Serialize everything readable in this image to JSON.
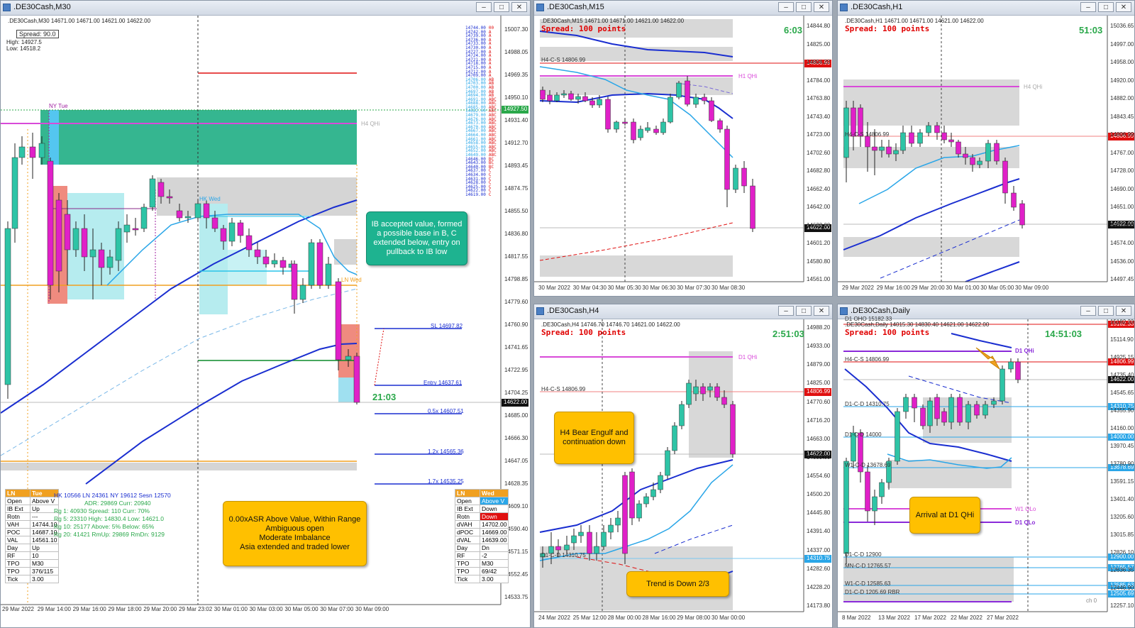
{
  "windows": {
    "m30": {
      "title": ".DE30Cash,M30",
      "header": ".DE30Cash,M30  14671.00 14671.00 14621.00 14622.00",
      "spread": "Spread: 90.0",
      "high": "High: 14927.5",
      "low": "Low: 14518.2",
      "timer": "21:03",
      "labels": {
        "ny_tue": "NY Tue",
        "h4_qhi": "H4 QHi",
        "hk_wed": "HK Wed",
        "ln_wed": "LN Wed"
      },
      "levels": {
        "sl": "SL  14697.82",
        "entry": "Entry  14637.61",
        "x05": "0.5x  14607.51",
        "x12": "1.2x  14565.36",
        "x17": "1.7x  14535.25"
      },
      "price_tags": {
        "green": "14927.50",
        "current": "14622.00"
      },
      "yaxis": [
        "15007.30",
        "14988.05",
        "14969.35",
        "14950.10",
        "14931.40",
        "14912.70",
        "14893.45",
        "14874.75",
        "14855.50",
        "14836.80",
        "14817.55",
        "14798.85",
        "14779.60",
        "14760.90",
        "14741.65",
        "14722.95",
        "14704.25",
        "14685.00",
        "14666.30",
        "14647.05",
        "14628.35",
        "14609.10",
        "14590.40",
        "14571.15",
        "14552.45",
        "14533.75"
      ],
      "xaxis": [
        "29 Mar 2022",
        "29 Mar 14:00",
        "29 Mar 16:00",
        "29 Mar 18:00",
        "29 Mar 20:00",
        "29 Mar 23:02",
        "30 Mar 01:00",
        "30 Mar 03:00",
        "30 Mar 05:00",
        "30 Mar 07:00",
        "30 Mar 09:00"
      ],
      "tpo_prices": [
        "14744.00",
        "14742.00",
        "14739.00",
        "14736.00",
        "14733.00",
        "14730.00",
        "14727.00",
        "14724.00",
        "14721.00",
        "14718.00",
        "14715.00",
        "14712.00",
        "14709.00",
        "14706.00",
        "14703.00",
        "14700.00",
        "14697.00",
        "14694.00",
        "14691.00",
        "14688.00",
        "14685.00",
        "14682.00",
        "14679.00",
        "14676.00",
        "14673.00",
        "14670.00",
        "14667.00",
        "14664.00",
        "14661.00",
        "14658.00",
        "14655.00",
        "14652.00",
        "14649.00",
        "14646.00",
        "14643.00",
        "14640.00",
        "14637.00",
        "14634.00",
        "14631.00",
        "14628.00",
        "14625.00",
        "14622.00",
        "14619.00"
      ],
      "tpo_letters": [
        "00",
        "A",
        "A",
        "A",
        "A",
        "A",
        "A",
        "A",
        "A",
        "A",
        "A",
        "A",
        "A",
        "AB",
        "AB",
        "AB",
        "AB",
        "AB",
        "ABC",
        "ABC",
        "ABC",
        "ABC",
        "ABC",
        "ABC",
        "ABC",
        "ABC",
        "ABC",
        "ABC",
        "ABC",
        "ABC",
        "ABC",
        "ABC",
        "ABC",
        "BC",
        "BC",
        "BC",
        "C",
        "C",
        "C",
        "C",
        "C",
        "C",
        "C"
      ],
      "left_table": [
        [
          "LN",
          "Tue"
        ],
        [
          "Open",
          "Above V"
        ],
        [
          "IB Ext",
          "Up"
        ],
        [
          "Rotn",
          "---"
        ],
        [
          "VAH",
          "14744.10"
        ],
        [
          "POC",
          "14687.10"
        ],
        [
          "VAL",
          "14561.10"
        ],
        [
          "Day",
          "Up"
        ],
        [
          "RF",
          "10"
        ],
        [
          "TPO",
          "M30"
        ],
        [
          "TPO",
          "376/115"
        ],
        [
          "Tick",
          "3.00"
        ]
      ],
      "stats": {
        "row1": "HK 10566   LN 24361   NY 19612   Sesn 12570",
        "row2": "ADR:   29869   Curr:   20940",
        "row3": "Rg  1:  40930  Spread:  110    Curr:   70%",
        "row4": "Rg  5:  23310  High:  14830.4  Low:  14621.0",
        "row5": "Rg 10:  25177  Above:    5%    Below:   65%",
        "row6": "Rg 20:  41421  RmUp: 29869     RmDn:  9129"
      },
      "right_table": [
        [
          "LN",
          "Wed"
        ],
        [
          "Open",
          "Above V"
        ],
        [
          "IB Ext",
          "Down"
        ],
        [
          "Rotn",
          "Down"
        ],
        [
          "dVAH",
          "14702.00"
        ],
        [
          "dPOC",
          "14669.00"
        ],
        [
          "dVAL",
          "14639.00"
        ],
        [
          "Day",
          "Dn"
        ],
        [
          "RF",
          "-2"
        ],
        [
          "TPO",
          "M30"
        ],
        [
          "TPO",
          "69/42"
        ],
        [
          "Tick",
          "3.00"
        ]
      ],
      "notes": {
        "teal": "IB accepted value, formed a possible base in B, C extended below, entry on pullback to IB low",
        "yellow": "0.00xASR Above Value, Within Range\nAmbiguous open\nModerate Imbalance\nAsia extended and traded lower"
      }
    },
    "m15": {
      "title": ".DE30Cash,M15",
      "header": ".DE30Cash,M15  14671.00 14671.00 14621.00 14622.00",
      "spread": "Spread: 100 points",
      "timer": "6:03",
      "labels": {
        "h4_cs": "H4-C-S 14806.99",
        "h1_qhi": "H1 QHi"
      },
      "price_tags": {
        "red": "14806.99",
        "current": "14622.00"
      },
      "yaxis": [
        "14844.80",
        "14825.00",
        "14804.20",
        "14784.00",
        "14763.80",
        "14743.40",
        "14723.00",
        "14702.60",
        "14682.80",
        "14662.40",
        "14642.00",
        "14622.00",
        "14601.20",
        "14580.80",
        "14561.00"
      ],
      "xaxis": [
        "30 Mar 2022",
        "30 Mar 04:30",
        "30 Mar 05:30",
        "30 Mar 06:30",
        "30 Mar 07:30",
        "30 Mar 08:30"
      ]
    },
    "h1": {
      "title": ".DE30Cash,H1",
      "header": ".DE30Cash,H1  14671.00 14671.00 14621.00 14622.00",
      "spread": "Spread: 100 points",
      "timer": "51:03",
      "labels": {
        "h4_cs": "H4-C-S 14806.99",
        "h4_qhi": "H4 QHi"
      },
      "price_tags": {
        "red": "14806.99",
        "current": "14622.00"
      },
      "yaxis": [
        "15036.65",
        "14997.00",
        "14958.00",
        "14920.00",
        "14882.00",
        "14843.45",
        "14806.99",
        "14767.00",
        "14728.00",
        "14690.00",
        "14651.00",
        "14622.00",
        "14574.00",
        "14536.00",
        "14497.45"
      ],
      "xaxis": [
        "29 Mar 2022",
        "29 Mar 16:00",
        "29 Mar 20:00",
        "30 Mar 01:00",
        "30 Mar 05:00",
        "30 Mar 09:00"
      ]
    },
    "h4": {
      "title": ".DE30Cash,H4",
      "header": ".DE30Cash,H4  14746.70 14746.70 14621.00 14622.00",
      "spread": "Spread: 100 points",
      "timer": "2:51:03",
      "labels": {
        "d1_qhi": "D1 QHi",
        "h4_cs": "H4-C-S 14806.99",
        "d1_cd": "D1-C-D 14310.75"
      },
      "price_tags": {
        "red": "14806.99",
        "current": "14622.00",
        "blue": "14310.75"
      },
      "yaxis": [
        "14988.20",
        "14933.00",
        "14879.00",
        "14825.00",
        "14770.60",
        "14716.20",
        "14663.00",
        "14609.00",
        "14554.60",
        "14500.20",
        "14445.80",
        "14391.40",
        "14337.00",
        "14282.60",
        "14228.20",
        "14173.80"
      ],
      "xaxis": [
        "24 Mar 2022",
        "25 Mar 12:00",
        "28 Mar 00:00",
        "28 Mar 16:00",
        "29 Mar 08:00",
        "30 Mar 00:00"
      ],
      "notes": {
        "engulf": "H4 Bear Engulf and continuation down",
        "trend": "Trend is Down 2/3"
      }
    },
    "daily": {
      "title": ".DE30Cash,Daily",
      "header": ".DE30Cash,Daily  14015.30 14830.40 14621.00 14622.00",
      "header2": "D1 OHO 15182.33",
      "spread": "Spread: 100 points",
      "timer": "14:51:03",
      "corner": "ch 0",
      "labels": {
        "d1_qhi": "D1 QHi",
        "h4_cs": "H4-C-S 14806.99",
        "d1_cd1": "D1-C-D 14310.75",
        "d1_cd2": "D1-C-D 14000",
        "w1": "W1-C-D 13678.69",
        "w1_qlo": "W1 QLo",
        "d1_qlo": "D1 QLo",
        "d1_cd3": "D1-C-D 12900",
        "mn1": "MN-C-D 12765.57",
        "w1b": "W1-C-D 12585.63",
        "d1_cd4": "D1-C-D 1205.69 RBR"
      },
      "price_tags": [
        "15182.33",
        "14806.99",
        "14622.00",
        "14310.75",
        "14000.00",
        "13678.69",
        "12900.00",
        "12765.57",
        "12585.63",
        "12505.69"
      ],
      "yaxis": [
        "15182.33",
        "15114.90",
        "14925.15",
        "14735.40",
        "14545.65",
        "14355.90",
        "14160.00",
        "13970.45",
        "13780.90",
        "13591.15",
        "13401.40",
        "13205.60",
        "13015.85",
        "12826.10",
        "12636.35",
        "12446.90",
        "12257.10"
      ],
      "xaxis": [
        "8 Mar 2022",
        "13 Mar 2022",
        "17 Mar 2022",
        "22 Mar 2022",
        "27 Mar 2022"
      ],
      "notes": {
        "arrival": "Arrival at D1 QHi"
      }
    }
  },
  "colors": {
    "bull": "#2ec4a6",
    "bear": "#e020c8",
    "ma_dark": "#1a2ed0",
    "ma_light": "#2aa6e8",
    "qhi": "#d94ad9",
    "red_line": "#e01010"
  }
}
